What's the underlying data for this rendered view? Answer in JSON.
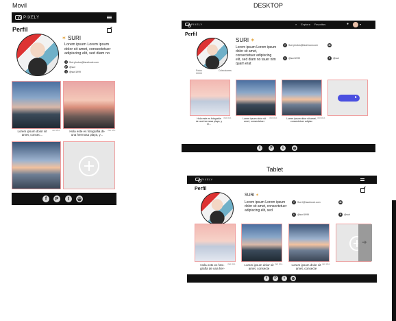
{
  "labels": {
    "movil": "Movil",
    "desktop": "DESKTOP",
    "tablet": "Tablet"
  },
  "app": {
    "logo_text": "PIXELY",
    "page_title": "Perfil"
  },
  "profile": {
    "name": "SURI",
    "description": "Lorem ipsum Lorem ipsum dolor sit amet, consectetuer adipiscing elit, sed diam no",
    "desktop_description": "Lorem ipsum Lorem ipsum dolor sit amet, consectetuer adipiscing elit, sed diam no tauer nim quam erat",
    "tablet_description": "Lorem ipsum Lorem ipsum dolor sit amet, consectetuer adipiscing elit, sed",
    "social": {
      "facebook": "Suri.photos@facebook.com",
      "pinterest": "@suri",
      "twitter": "@suri1999",
      "desktop_facebook": "Suri.photos@facebook.com",
      "desktop_twitter": "@suri1999",
      "desktop_pinterest": "@suri",
      "tablet_facebook": "Suri.f@facebook.com",
      "tablet_twitter": "@suri1999",
      "tablet_pinterest": "@suri"
    }
  },
  "desktop_nav": {
    "explore": "Explora",
    "favorites": "Favoritos"
  },
  "desktop_tabs": [
    "Fotos",
    "Colecciones"
  ],
  "captions": {
    "m1": "Lorem ipsum dolor sit amet, consec...",
    "m2": "Hola este es fotografia de una hermosa playa, y...",
    "d1": "Hola este es fotografía de una hermosa playa, y el...",
    "d2": "Lorem ipsum dolor sit amet, consectetuer",
    "d3": "Lorem ipsum dolor sit amet, consectetuer adipisc",
    "t1": "Hola este es foto-grafía de una her-",
    "t2": "Lorem ipsum dolor sit amet, consecte",
    "t3": "Lorem ipsum dolor sit amet, consecte"
  },
  "caption_tag": "VER MÁS",
  "footer_icons": [
    "facebook-icon",
    "pinterest-icon",
    "twitter-icon",
    "globe-icon"
  ],
  "glyphs": {
    "facebook": "f",
    "pinterest": "P",
    "twitter": "t",
    "globe": "⊕",
    "mail": "✉",
    "bell": "●"
  }
}
